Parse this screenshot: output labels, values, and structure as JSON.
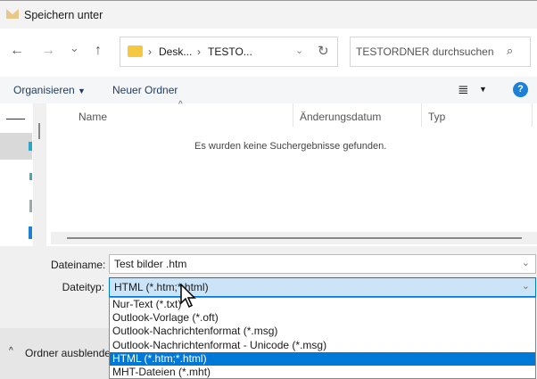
{
  "title": "Speichern unter",
  "nav": {
    "back": "←",
    "forward": "→",
    "recent": "⌄",
    "up": "↑",
    "breadcrumb": [
      "Desk...",
      "TESTO..."
    ],
    "refresh": "↻",
    "search_placeholder": "TESTORDNER durchsuchen"
  },
  "toolbar": {
    "organize": "Organisieren",
    "new_folder": "Neuer Ordner",
    "help": "?"
  },
  "columns": [
    "Name",
    "Änderungsdatum",
    "Typ"
  ],
  "empty_message": "Es wurden keine Suchergebnisse gefunden.",
  "form": {
    "filename_label": "Dateiname:",
    "filename_value": "Test bilder .htm",
    "filetype_label": "Dateityp:",
    "filetype_value": "HTML (*.htm;*.html)"
  },
  "filetype_options": [
    "Nur-Text (*.txt)",
    "Outlook-Vorlage (*.oft)",
    "Outlook-Nachrichtenformat (*.msg)",
    "Outlook-Nachrichtenformat - Unicode (*.msg)",
    "HTML (*.htm;*.html)",
    "MHT-Dateien (*.mht)"
  ],
  "selected_option_index": 4,
  "hide_folders": "Ordner ausblenden",
  "colors": {
    "accent": "#0078d7",
    "selected_field": "#cce4f7"
  }
}
